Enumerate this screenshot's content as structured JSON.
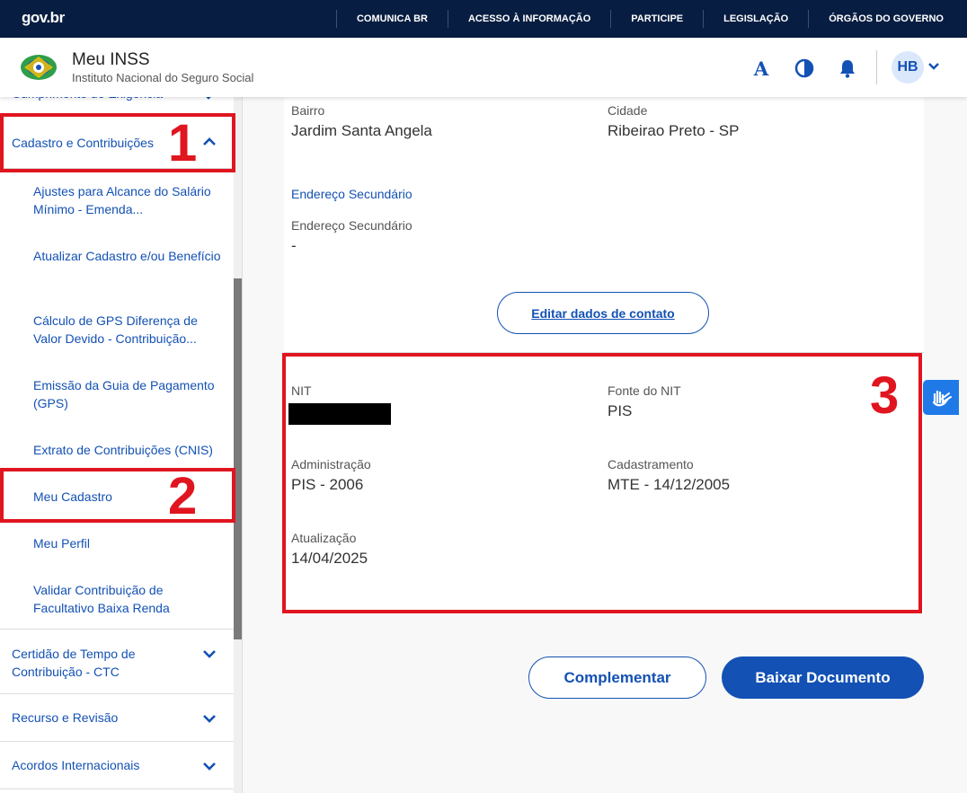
{
  "govbar": {
    "logo": "gov.br",
    "links": [
      "COMUNICA BR",
      "ACESSO À INFORMAÇÃO",
      "PARTICIPE",
      "LEGISLAÇÃO",
      "ÓRGÃOS DO GOVERNO"
    ]
  },
  "header": {
    "title": "Meu INSS",
    "subtitle": "Instituto Nacional do Seguro Social",
    "font_tool": "A",
    "avatar_initials": "HB"
  },
  "sidebar": {
    "top_partial": "Cumprimento de Exigência",
    "section_expanded": "Cadastro e Contribuições",
    "sub_items": [
      "Ajustes para Alcance do Salário Mínimo - Emenda...",
      "Atualizar Cadastro e/ou Benefício",
      "Cálculo de GPS Diferença de Valor Devido - Contribuição...",
      "Emissão da Guia de Pagamento (GPS)",
      "Extrato de Contribuições (CNIS)",
      "Meu Cadastro",
      "Meu Perfil",
      "Validar Contribuição de Facultativo Baixa Renda"
    ],
    "sections_collapsed": [
      "Certidão de Tempo de Contribuição - CTC",
      "Recurso e Revisão",
      "Acordos Internacionais"
    ]
  },
  "annotations": [
    "1",
    "2",
    "3"
  ],
  "address": {
    "bairro_label": "Bairro",
    "bairro_value": "Jardim Santa Angela",
    "cidade_label": "Cidade",
    "cidade_value": "Ribeirao Preto - SP",
    "secondary_link": "Endereço Secundário",
    "secondary_label": "Endereço Secundário",
    "secondary_value": "-",
    "edit_button": "Editar dados de contato"
  },
  "nit": {
    "nit_label": "NIT",
    "fonte_label": "Fonte do NIT",
    "fonte_value": "PIS",
    "admin_label": "Administração",
    "admin_value": "PIS - 2006",
    "cadastro_label": "Cadastramento",
    "cadastro_value": "MTE - 14/12/2005",
    "atualizacao_label": "Atualização",
    "atualizacao_value": "14/04/2025"
  },
  "actions": {
    "complementar": "Complementar",
    "baixar": "Baixar Documento"
  },
  "colors": {
    "govbar_bg": "#071d41",
    "primary": "#1351b4",
    "annotation_red": "#e0151f",
    "vlibras": "#1f7ae8"
  }
}
